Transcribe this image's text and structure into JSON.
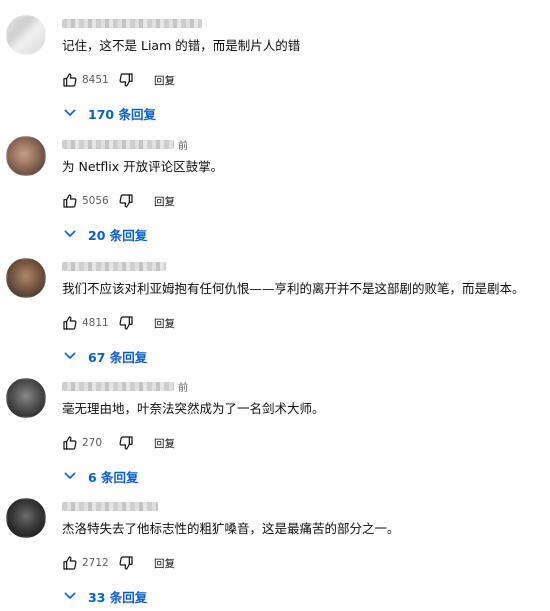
{
  "accent_color": "#065fd4",
  "icons": {
    "like": "thumb-up-icon",
    "dislike": "thumb-down-icon",
    "expand": "chevron-down-icon"
  },
  "comments": [
    {
      "author_suffix": "",
      "text": "记住，这不是 Liam 的错，而是制片人的错",
      "likes": "8451",
      "reply_label": "回复",
      "replies_label": "170 条回复"
    },
    {
      "author_suffix": "前",
      "text": "为 Netflix 开放评论区鼓掌。",
      "likes": "5056",
      "reply_label": "回复",
      "replies_label": "20 条回复"
    },
    {
      "author_suffix": "",
      "text": "我们不应该对利亚姆抱有任何仇恨——亨利的离开并不是这部剧的败笔，而是剧本。",
      "likes": "4811",
      "reply_label": "回复",
      "replies_label": "67 条回复"
    },
    {
      "author_suffix": "前",
      "text": "毫无理由地，叶奈法突然成为了一名剑术大师。",
      "likes": "270",
      "reply_label": "回复",
      "replies_label": "6 条回复"
    },
    {
      "author_suffix": "",
      "text": "杰洛特失去了他标志性的粗犷嗓音，这是最痛苦的部分之一。",
      "likes": "2712",
      "reply_label": "回复",
      "replies_label": "33 条回复"
    }
  ]
}
